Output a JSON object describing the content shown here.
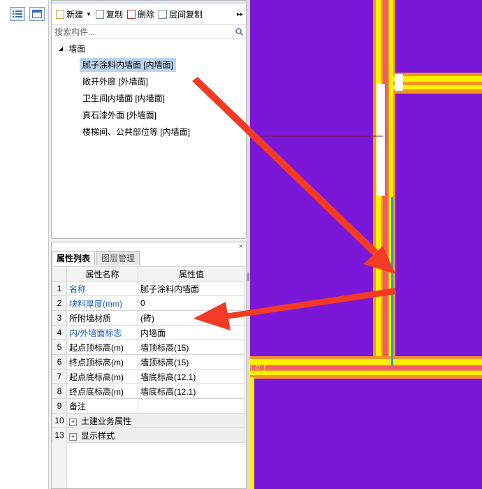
{
  "toolbar": {
    "new": "新建",
    "copy": "复制",
    "delete": "删除",
    "floor_copy": "层间复制",
    "more": "▸▸"
  },
  "search": {
    "placeholder": "搜索构件..."
  },
  "tree": {
    "root": "墙面",
    "items": [
      {
        "label": "腻子涂料内墙面 [内墙面]"
      },
      {
        "label": "敞开外廊 [外墙面]"
      },
      {
        "label": "卫生间内墙面 [内墙面]"
      },
      {
        "label": "真石漆外面 [外墙面]"
      },
      {
        "label": "楼梯间、公共部位等 [内墙面]"
      }
    ]
  },
  "props": {
    "tabs": [
      "属性列表",
      "图层管理"
    ],
    "headers": {
      "name": "属性名称",
      "value": "属性值"
    },
    "rows": [
      {
        "no": "1",
        "name": "名称",
        "value": "腻子涂料内墙面"
      },
      {
        "no": "2",
        "name": "块料厚度(mm)",
        "value": "0"
      },
      {
        "no": "3",
        "name": "所附墙材质",
        "value": "(砖)"
      },
      {
        "no": "4",
        "name": "内/外墙面标志",
        "value": "内墙面"
      },
      {
        "no": "5",
        "name": "起点顶标高(m)",
        "value": "墙顶标高(15)"
      },
      {
        "no": "6",
        "name": "终点顶标高(m)",
        "value": "墙顶标高(15)"
      },
      {
        "no": "7",
        "name": "起点底标高(m)",
        "value": "墙底标高(12.1)"
      },
      {
        "no": "8",
        "name": "终点底标高(m)",
        "value": "墙底标高(12.1)"
      },
      {
        "no": "9",
        "name": "备注",
        "value": ""
      }
    ],
    "groups": [
      {
        "no": "10",
        "label": "土建业务属性"
      },
      {
        "no": "13",
        "label": "显示样式"
      }
    ]
  },
  "canvas": {
    "axis_label": "D"
  },
  "colors": {
    "canvas_bg": "#7a17d8",
    "wall_outer": "#f7941d",
    "wall_inner": "#fff200",
    "arrow": "#f23b24",
    "highlight_line": "#1aa3d9"
  }
}
